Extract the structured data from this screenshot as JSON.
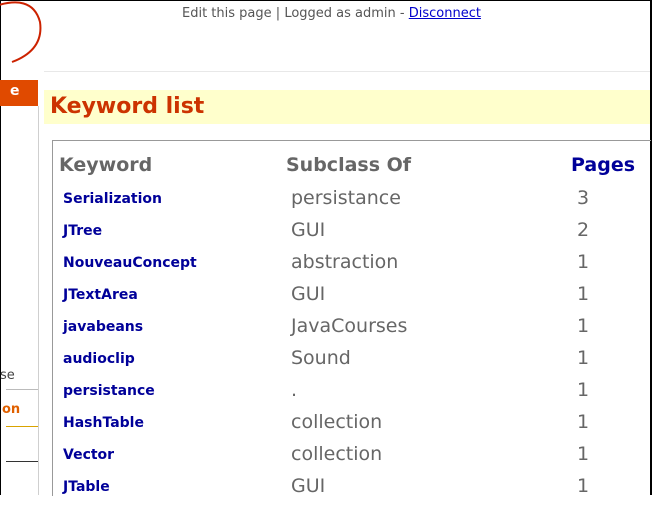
{
  "top_bar": {
    "edit_label": "Edit this page",
    "separator": "|",
    "logged_as": "Logged as admin -",
    "disconnect_label": "Disconnect"
  },
  "left_strip": {
    "orange_tab_text": "e",
    "partial_text": "se",
    "partial_link": "on"
  },
  "page_title": "Keyword list",
  "table": {
    "headers": {
      "keyword": "Keyword",
      "subclass": "Subclass Of",
      "pages": "Pages"
    },
    "rows": [
      {
        "keyword": "Serialization",
        "subclass": "persistance",
        "pages": "3"
      },
      {
        "keyword": "JTree",
        "subclass": "GUI",
        "pages": "2"
      },
      {
        "keyword": "NouveauConcept",
        "subclass": "abstraction",
        "pages": "1"
      },
      {
        "keyword": "JTextArea",
        "subclass": "GUI",
        "pages": "1"
      },
      {
        "keyword": "javabeans",
        "subclass": "JavaCourses",
        "pages": "1"
      },
      {
        "keyword": "audioclip",
        "subclass": "Sound",
        "pages": "1"
      },
      {
        "keyword": "persistance",
        "subclass": ".",
        "pages": "1"
      },
      {
        "keyword": "HashTable",
        "subclass": "collection",
        "pages": "1"
      },
      {
        "keyword": "Vector",
        "subclass": "collection",
        "pages": "1"
      },
      {
        "keyword": "JTable",
        "subclass": "GUI",
        "pages": "1"
      }
    ]
  },
  "colors": {
    "title_text": "#cc3300",
    "title_bg": "#ffffcc",
    "link": "#000099",
    "orange_tab": "#e04a00"
  }
}
